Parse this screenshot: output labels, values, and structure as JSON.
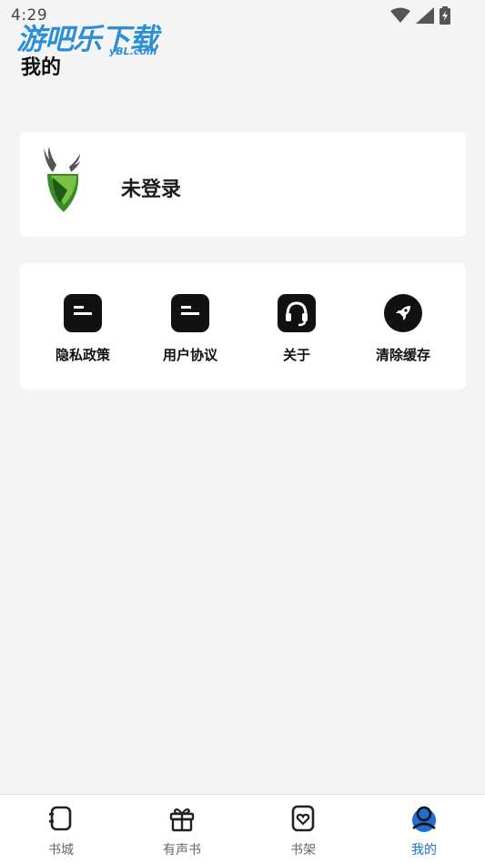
{
  "status_bar": {
    "time": "4:29"
  },
  "watermark": {
    "title": "游吧乐下载",
    "sub": "yBL.com"
  },
  "header": {
    "title": "我的"
  },
  "profile": {
    "login_status": "未登录",
    "avatar_icon": "deer-logo-icon"
  },
  "menu": {
    "items": [
      {
        "label": "隐私政策",
        "icon": "document-icon"
      },
      {
        "label": "用户协议",
        "icon": "document-icon"
      },
      {
        "label": "关于",
        "icon": "headset-icon"
      },
      {
        "label": "清除缓存",
        "icon": "rocket-icon"
      }
    ]
  },
  "bottom_nav": {
    "items": [
      {
        "label": "书城",
        "icon": "book-icon"
      },
      {
        "label": "有声书",
        "icon": "gift-icon"
      },
      {
        "label": "书架",
        "icon": "bookshelf-icon"
      },
      {
        "label": "我的",
        "icon": "user-icon",
        "active": true
      }
    ]
  },
  "colors": {
    "accent": "#1d6fd6",
    "background": "#f4f4f4",
    "icon_bg": "#111111"
  }
}
